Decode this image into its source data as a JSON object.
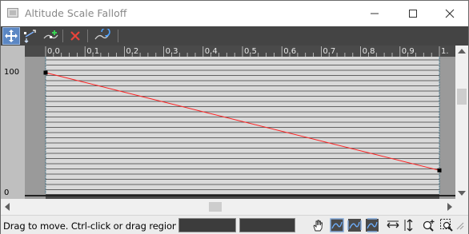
{
  "window": {
    "title": "Altitude Scale Falloff"
  },
  "toolbar": {
    "buttons": [
      {
        "name": "move-keys-icon",
        "active": true
      },
      {
        "name": "scale-keys-icon",
        "active": false
      },
      {
        "name": "add-key-icon",
        "active": false
      },
      {
        "name": "delete-key-icon",
        "active": false
      },
      {
        "name": "reset-curve-icon",
        "active": false
      }
    ]
  },
  "graph": {
    "x_ticks": [
      "0.0",
      "0.1",
      "0.2",
      "0.3",
      "0.4",
      "0.5",
      "0.6",
      "0.7",
      "0.8",
      "0.9",
      "1."
    ],
    "y_labels": {
      "top": "100",
      "bottom": "0"
    },
    "curve": {
      "points": [
        {
          "x": 0.0,
          "y": 100
        },
        {
          "x": 1.0,
          "y": 19
        }
      ],
      "color": "#ff2020"
    }
  },
  "status": {
    "message": "Drag to move. Ctrl-click or drag region box tc",
    "field1": "",
    "field2": ""
  },
  "colors": {
    "graph_bg": "#d9d9d9",
    "grid_line": "#3a3a3a",
    "toolbar_bg": "#444444",
    "active_button": "#5b87c4"
  }
}
